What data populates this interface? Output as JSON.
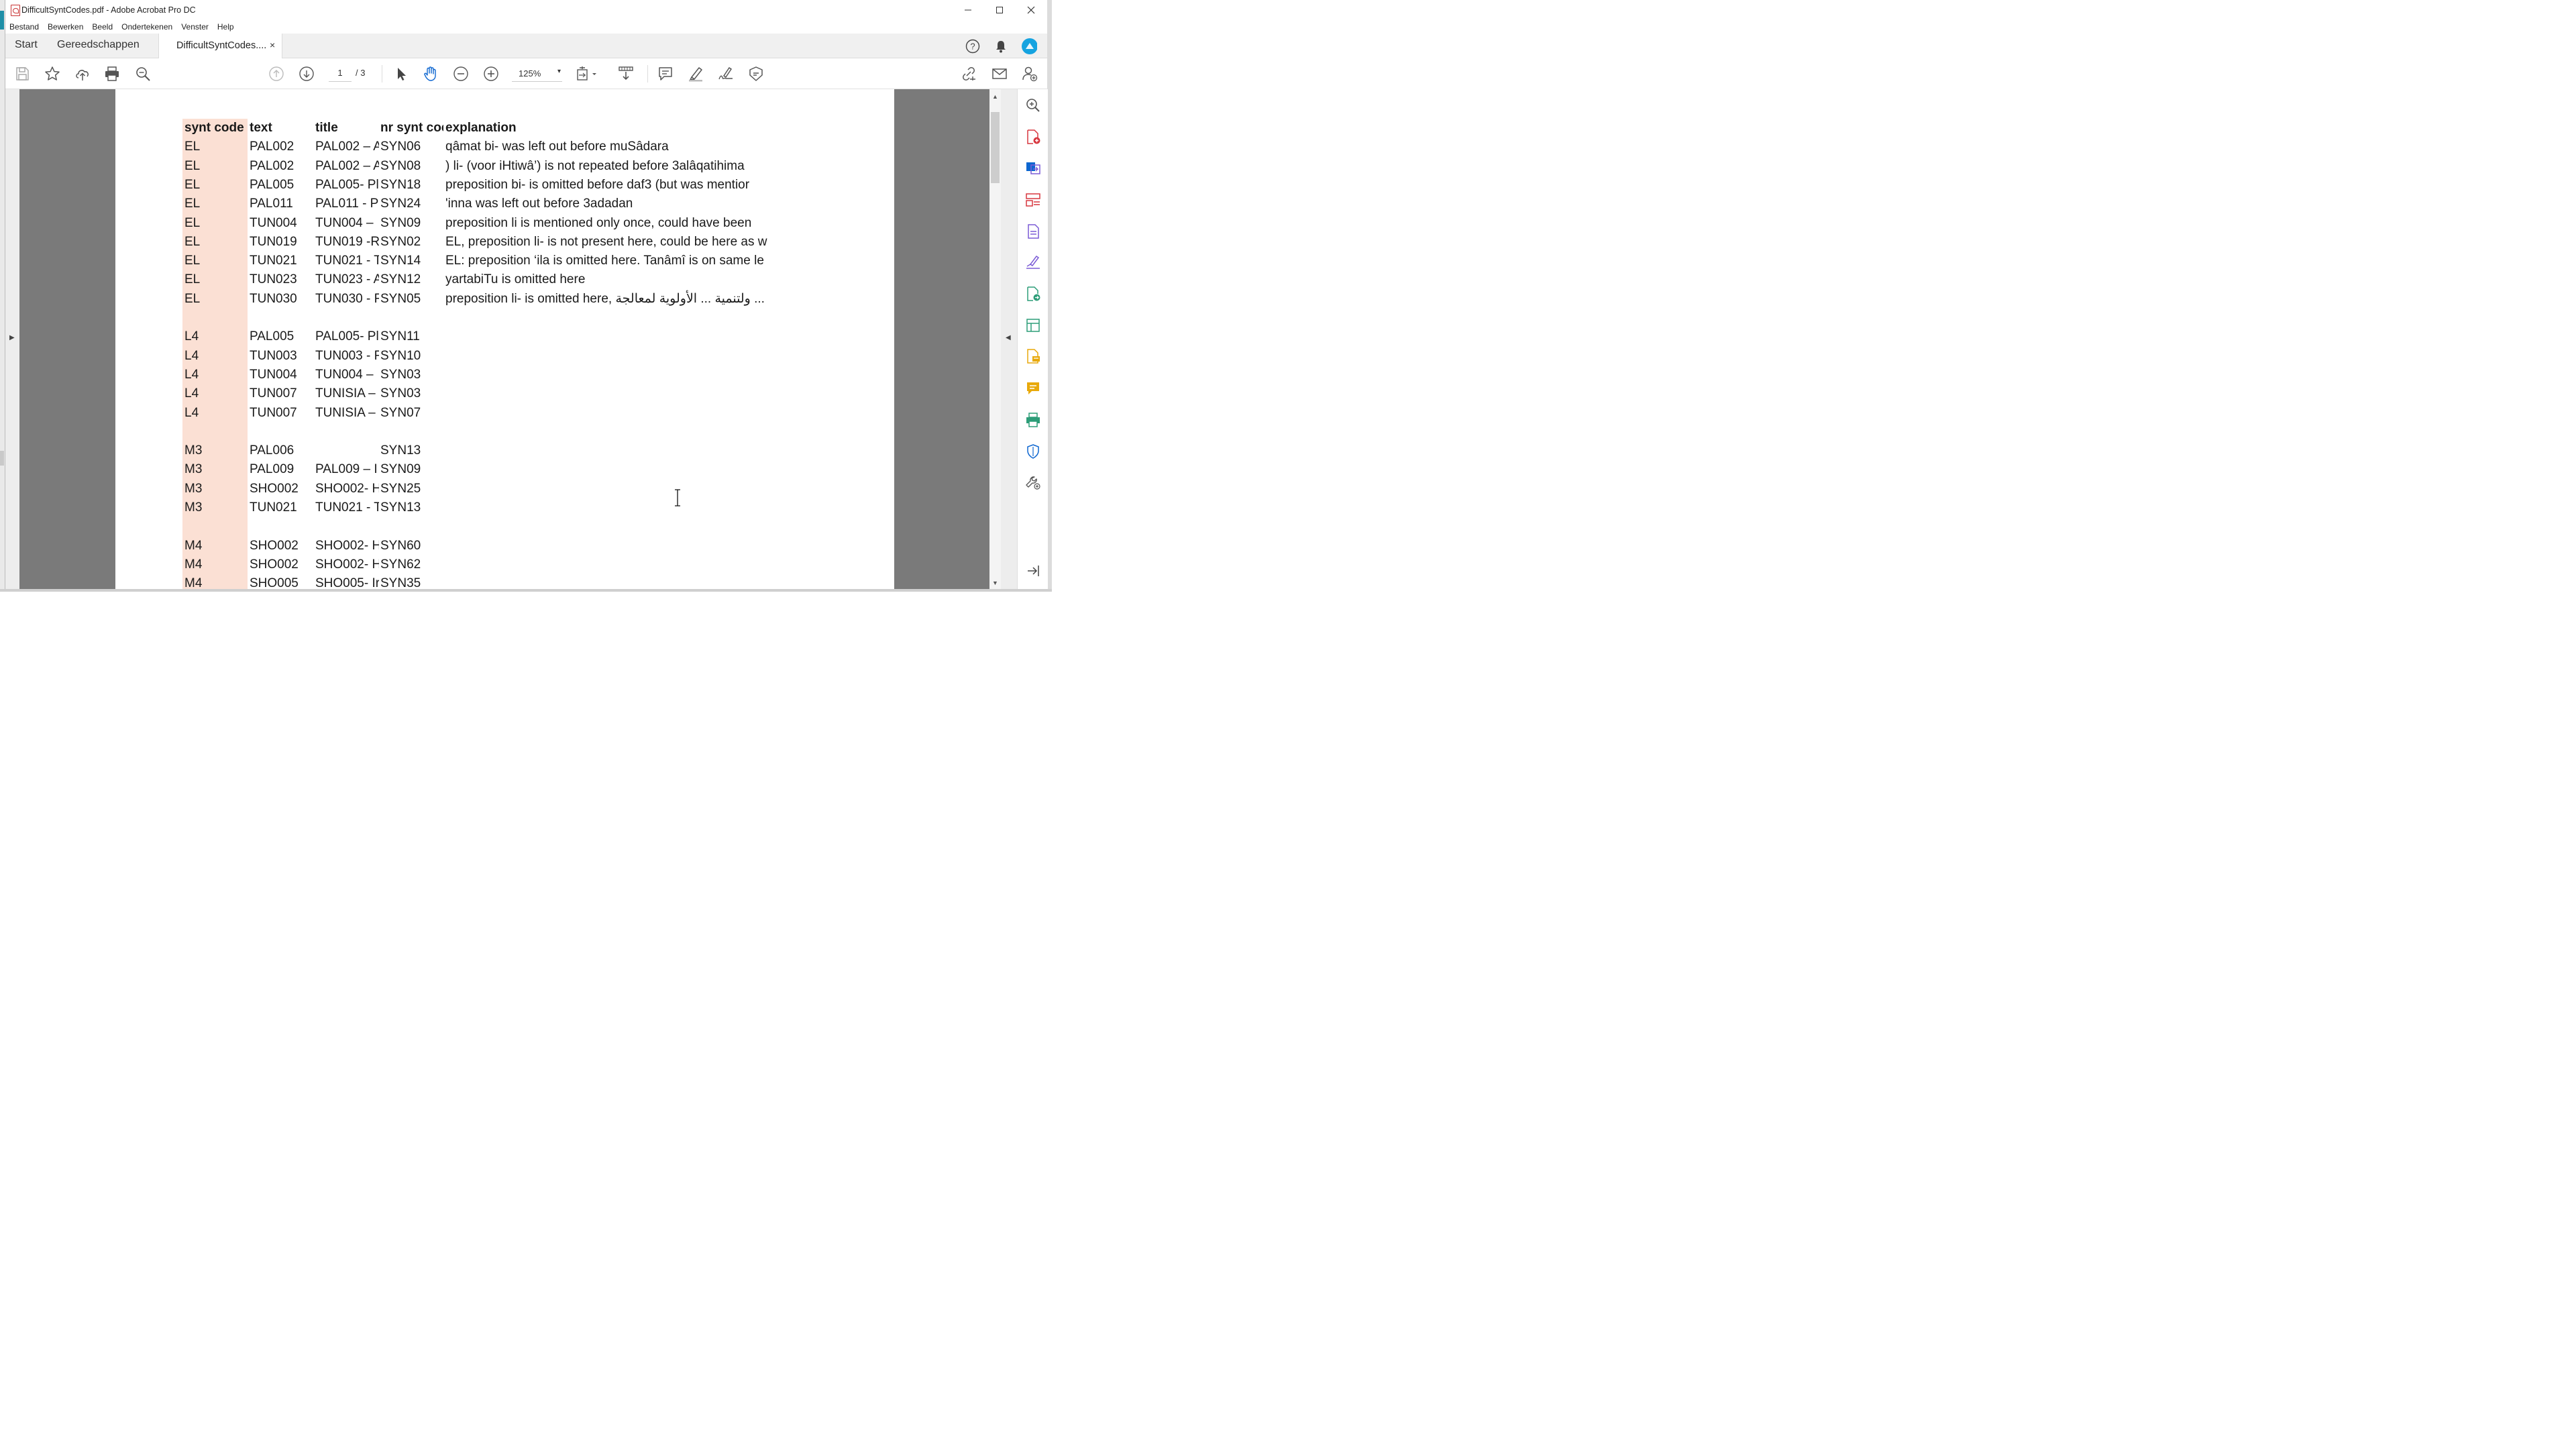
{
  "window": {
    "title": "DifficultSyntCodes.pdf - Adobe Acrobat Pro DC",
    "minimize": "—",
    "maximize": "☐",
    "close": "✕"
  },
  "menu": [
    "Bestand",
    "Bewerken",
    "Beeld",
    "Ondertekenen",
    "Venster",
    "Help"
  ],
  "tabs": {
    "start": "Start",
    "tools": "Gereedschappen",
    "document": "DifficultSyntCodes....",
    "document_close": "×"
  },
  "toolbar": {
    "current_page": "1",
    "total_pages": "/ 3",
    "zoom": "125%",
    "zoom_caret": "▾"
  },
  "colors": {
    "highlight": "#fbe0d4",
    "accent_blue": "#0d66d0",
    "purple": "#7b5bd6",
    "red": "#d7373f",
    "green": "#2d9d78",
    "yellow": "#e8a90b"
  },
  "table": {
    "headers": [
      "synt code",
      "text",
      "title",
      "nr synt coc",
      "explanation"
    ],
    "rows": [
      [
        "EL",
        "PAL002",
        "PAL002 – A",
        "SYN06",
        "qâmat bi- was left out before muSâdara"
      ],
      [
        "EL",
        "PAL002",
        "PAL002 – A",
        "SYN08",
        ") li- (voor iHtiwâ’) is not repeated before 3alâqatihima"
      ],
      [
        "EL",
        "PAL005",
        "PAL005- Pl",
        "SYN18",
        "preposition bi- is omitted before daf3 (but was mentior"
      ],
      [
        "EL",
        "PAL011",
        "PAL011 - P",
        "SYN24",
        "'inna was left out before 3adadan"
      ],
      [
        "EL",
        "TUN004",
        "TUN004 –",
        "SYN09",
        "preposition li is mentioned only once, could have been"
      ],
      [
        "EL",
        "TUN019",
        "TUN019 -R",
        "SYN02",
        "EL, preposition li- is not present here, could be here as w"
      ],
      [
        "EL",
        "TUN021",
        "TUN021 - T",
        "SYN14",
        "EL: preposition ‘ila is omitted here. Tanâmî is on same le"
      ],
      [
        "EL",
        "TUN023",
        "TUN023 - A",
        "SYN12",
        "yartabiTu is omitted here"
      ],
      [
        "EL",
        "TUN030",
        "TUN030 - F",
        "SYN05",
        "preposition li- is omitted here, ولتنمية ... الأولوية لمعالجة ..."
      ],
      [
        "",
        "",
        "",
        "",
        ""
      ],
      [
        "L4",
        "PAL005",
        "PAL005- Pl",
        "SYN11",
        ""
      ],
      [
        "L4",
        "TUN003",
        "TUN003 - F",
        "SYN10",
        ""
      ],
      [
        "L4",
        "TUN004",
        "TUN004 –",
        "SYN03",
        ""
      ],
      [
        "L4",
        "TUN007",
        "TUNISIA –",
        "SYN03",
        ""
      ],
      [
        "L4",
        "TUN007",
        "TUNISIA –",
        "SYN07",
        ""
      ],
      [
        "",
        "",
        "",
        "",
        ""
      ],
      [
        "M3",
        "PAL006",
        "",
        "SYN13",
        ""
      ],
      [
        "M3",
        "PAL009",
        "PAL009 – I",
        "SYN09",
        ""
      ],
      [
        "M3",
        "SHO002",
        "SHO002- H",
        "SYN25",
        ""
      ],
      [
        "M3",
        "TUN021",
        "TUN021 - T",
        "SYN13",
        ""
      ],
      [
        "",
        "",
        "",
        "",
        ""
      ],
      [
        "M4",
        "SHO002",
        "SHO002- H",
        "SYN60",
        ""
      ],
      [
        "M4",
        "SHO002",
        "SHO002- H",
        "SYN62",
        ""
      ],
      [
        "M4",
        "SHO005",
        "SHO005- Ir",
        "SYN35",
        ""
      ]
    ]
  },
  "icons": {
    "toolbar": [
      "save-icon",
      "bookmark-star-icon",
      "upload-cloud-icon",
      "print-icon",
      "search-zoom-icon",
      "page-up-icon",
      "page-down-icon",
      "select-arrow-icon",
      "hand-icon",
      "zoom-out-icon",
      "zoom-in-icon",
      "page-fit-icon",
      "scroll-mode-icon",
      "comment-icon",
      "highlight-pen-icon",
      "sign-icon",
      "stamp-icon",
      "share-link-icon",
      "email-icon",
      "add-user-icon"
    ],
    "tools_panel": [
      "zoom-tool-icon",
      "export-pdf-icon",
      "create-pdf-icon",
      "organize-pages-icon",
      "edit-pdf-icon",
      "fill-sign-icon",
      "export-pdf-green-icon",
      "compress-icon",
      "send-for-review-icon",
      "comment-tool-icon",
      "print-production-icon",
      "protect-icon",
      "more-tools-icon",
      "collapse-panel-icon"
    ]
  }
}
